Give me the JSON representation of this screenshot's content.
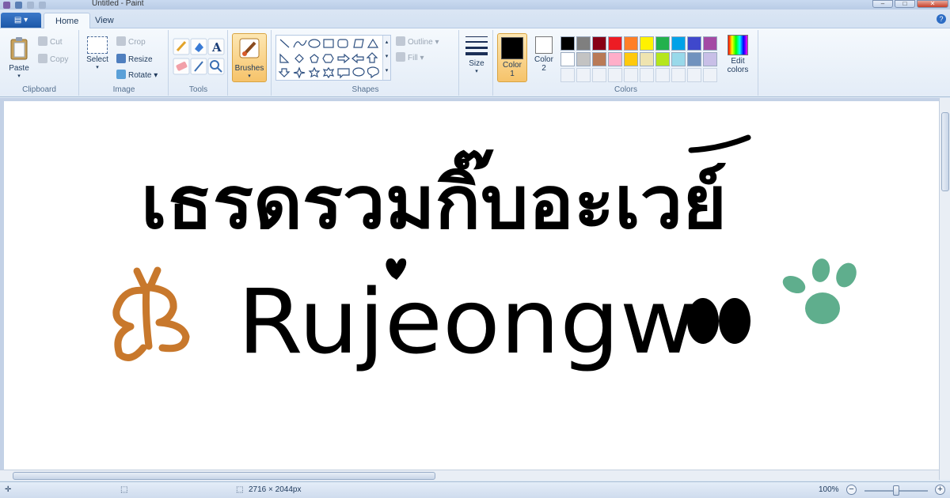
{
  "window": {
    "title": "Untitled - Paint"
  },
  "tabs": [
    {
      "label": "Home"
    },
    {
      "label": "View"
    }
  ],
  "clipboard": {
    "paste": "Paste",
    "cut": "Cut",
    "copy": "Copy",
    "label": "Clipboard"
  },
  "image": {
    "select": "Select",
    "crop": "Crop",
    "resize": "Resize",
    "rotate": "Rotate",
    "label": "Image"
  },
  "tools": {
    "label": "Tools"
  },
  "brushes": {
    "label": "Brushes"
  },
  "shapes": {
    "outline": "Outline",
    "fill": "Fill",
    "label": "Shapes"
  },
  "size": {
    "label": "Size"
  },
  "colors": {
    "color1_line1": "Color",
    "color1_line2": "1",
    "color2_line1": "Color",
    "color2_line2": "2",
    "edit_line1": "Edit",
    "edit_line2": "colors",
    "label": "Colors",
    "color1_value": "#000000",
    "color2_value": "#ffffff",
    "palette": [
      "#000000",
      "#7f7f7f",
      "#880015",
      "#ed1c24",
      "#ff7f27",
      "#fff200",
      "#22b14c",
      "#00a2e8",
      "#3f48cc",
      "#a349a4",
      "#ffffff",
      "#c3c3c3",
      "#b97a57",
      "#ffaec9",
      "#ffc90e",
      "#efe4b0",
      "#b5e61d",
      "#99d9ea",
      "#7092be",
      "#c8bfe7"
    ]
  },
  "drawing": {
    "thai_text": "เธรดรวมกิ๊บอะเวย์",
    "name_text": "Rujeongw",
    "butterfly_color": "#c8782c",
    "paw_color": "#5fae8d",
    "ink_color": "#000000"
  },
  "status": {
    "dimensions": "2716 × 2044px",
    "zoom": "100%"
  }
}
